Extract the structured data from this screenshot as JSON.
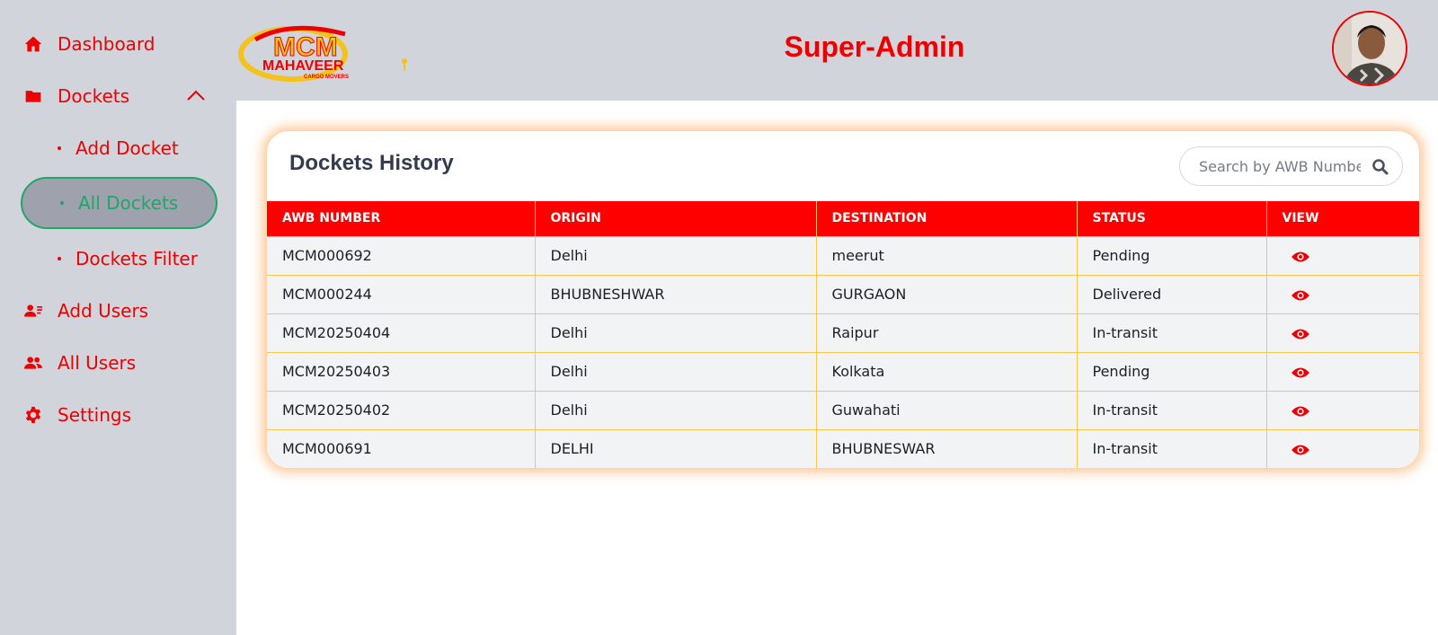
{
  "sidebar": {
    "items": [
      {
        "label": "Dashboard",
        "icon": "home-icon"
      },
      {
        "label": "Dockets",
        "icon": "folder-icon"
      },
      {
        "label": "Add Users",
        "icon": "user-list-icon"
      },
      {
        "label": "All Users",
        "icon": "users-icon"
      },
      {
        "label": "Settings",
        "icon": "gear-icon"
      }
    ],
    "sub_items": [
      {
        "label": "Add Docket"
      },
      {
        "label": "All Dockets",
        "active": true
      },
      {
        "label": "Dockets Filter"
      }
    ]
  },
  "header": {
    "logo_text": "MCM",
    "logo_sub": "MAHAVEER",
    "logo_tag": "CARGO MOVERS",
    "title": "Super-Admin"
  },
  "dockets": {
    "title": "Dockets History",
    "search_placeholder": "Search by AWB Number",
    "columns": [
      "AWB NUMBER",
      "ORIGIN",
      "DESTINATION",
      "STATUS",
      "VIEW"
    ],
    "rows": [
      [
        "MCM000692",
        "Delhi",
        "meerut",
        "Pending"
      ],
      [
        "MCM000244",
        "BHUBNESHWAR",
        "GURGAON",
        "Delivered"
      ],
      [
        "MCM20250404",
        "Delhi",
        "Raipur",
        "In-transit"
      ],
      [
        "MCM20250403",
        "Delhi",
        "Kolkata",
        "Pending"
      ],
      [
        "MCM20250402",
        "Delhi",
        "Guwahati",
        "In-transit"
      ],
      [
        "MCM000691",
        "DELHI",
        "BHUBNESWAR",
        "In-transit"
      ]
    ]
  },
  "colors": {
    "accent": "#ee0000",
    "active": "#1ea66a",
    "sidebar_bg": "#d2d4dc",
    "table_header": "#ff0000",
    "table_border": "#f7c64a"
  }
}
